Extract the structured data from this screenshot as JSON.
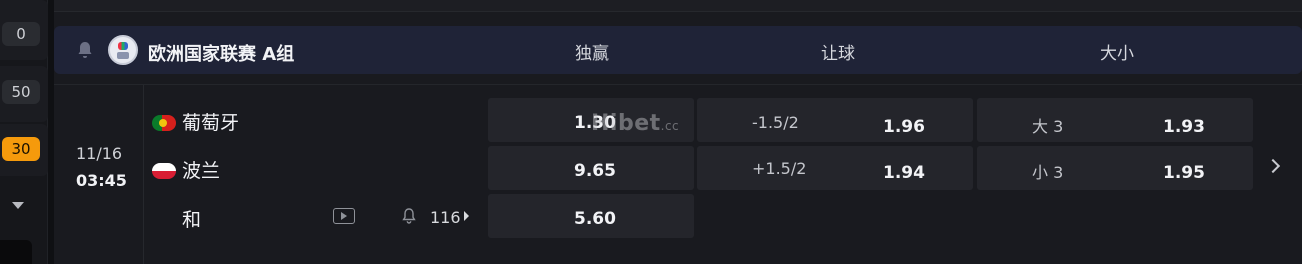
{
  "sidebar": {
    "badges": [
      {
        "label": "0",
        "active": false
      },
      {
        "label": "50",
        "active": false
      },
      {
        "label": "30",
        "active": true
      }
    ]
  },
  "league": {
    "title": "欧洲国家联赛 A组",
    "columns": [
      "独赢",
      "让球",
      "大小"
    ]
  },
  "match": {
    "date": "11/16",
    "time": "03:45",
    "home": {
      "name": "葡萄牙",
      "flag": "portugal-flag"
    },
    "away": {
      "name": "波兰",
      "flag": "poland-flag"
    },
    "draw_label": "和",
    "more_markets": "116",
    "moneyline": {
      "home": "1.30",
      "away": "9.65",
      "draw": "5.60"
    },
    "handicap": {
      "home": {
        "line": "-1.5/2",
        "odds": "1.96"
      },
      "away": {
        "line": "+1.5/2",
        "odds": "1.94"
      }
    },
    "totals": {
      "over": {
        "line": "大 3",
        "odds": "1.93"
      },
      "under": {
        "line": "小 3",
        "odds": "1.95"
      }
    }
  },
  "watermark": {
    "text": "Hibet",
    "suffix": ".cc"
  },
  "colors": {
    "accent": "#f59a0c",
    "header_bg": "#1f2337",
    "cell_bg": "#24252b"
  }
}
